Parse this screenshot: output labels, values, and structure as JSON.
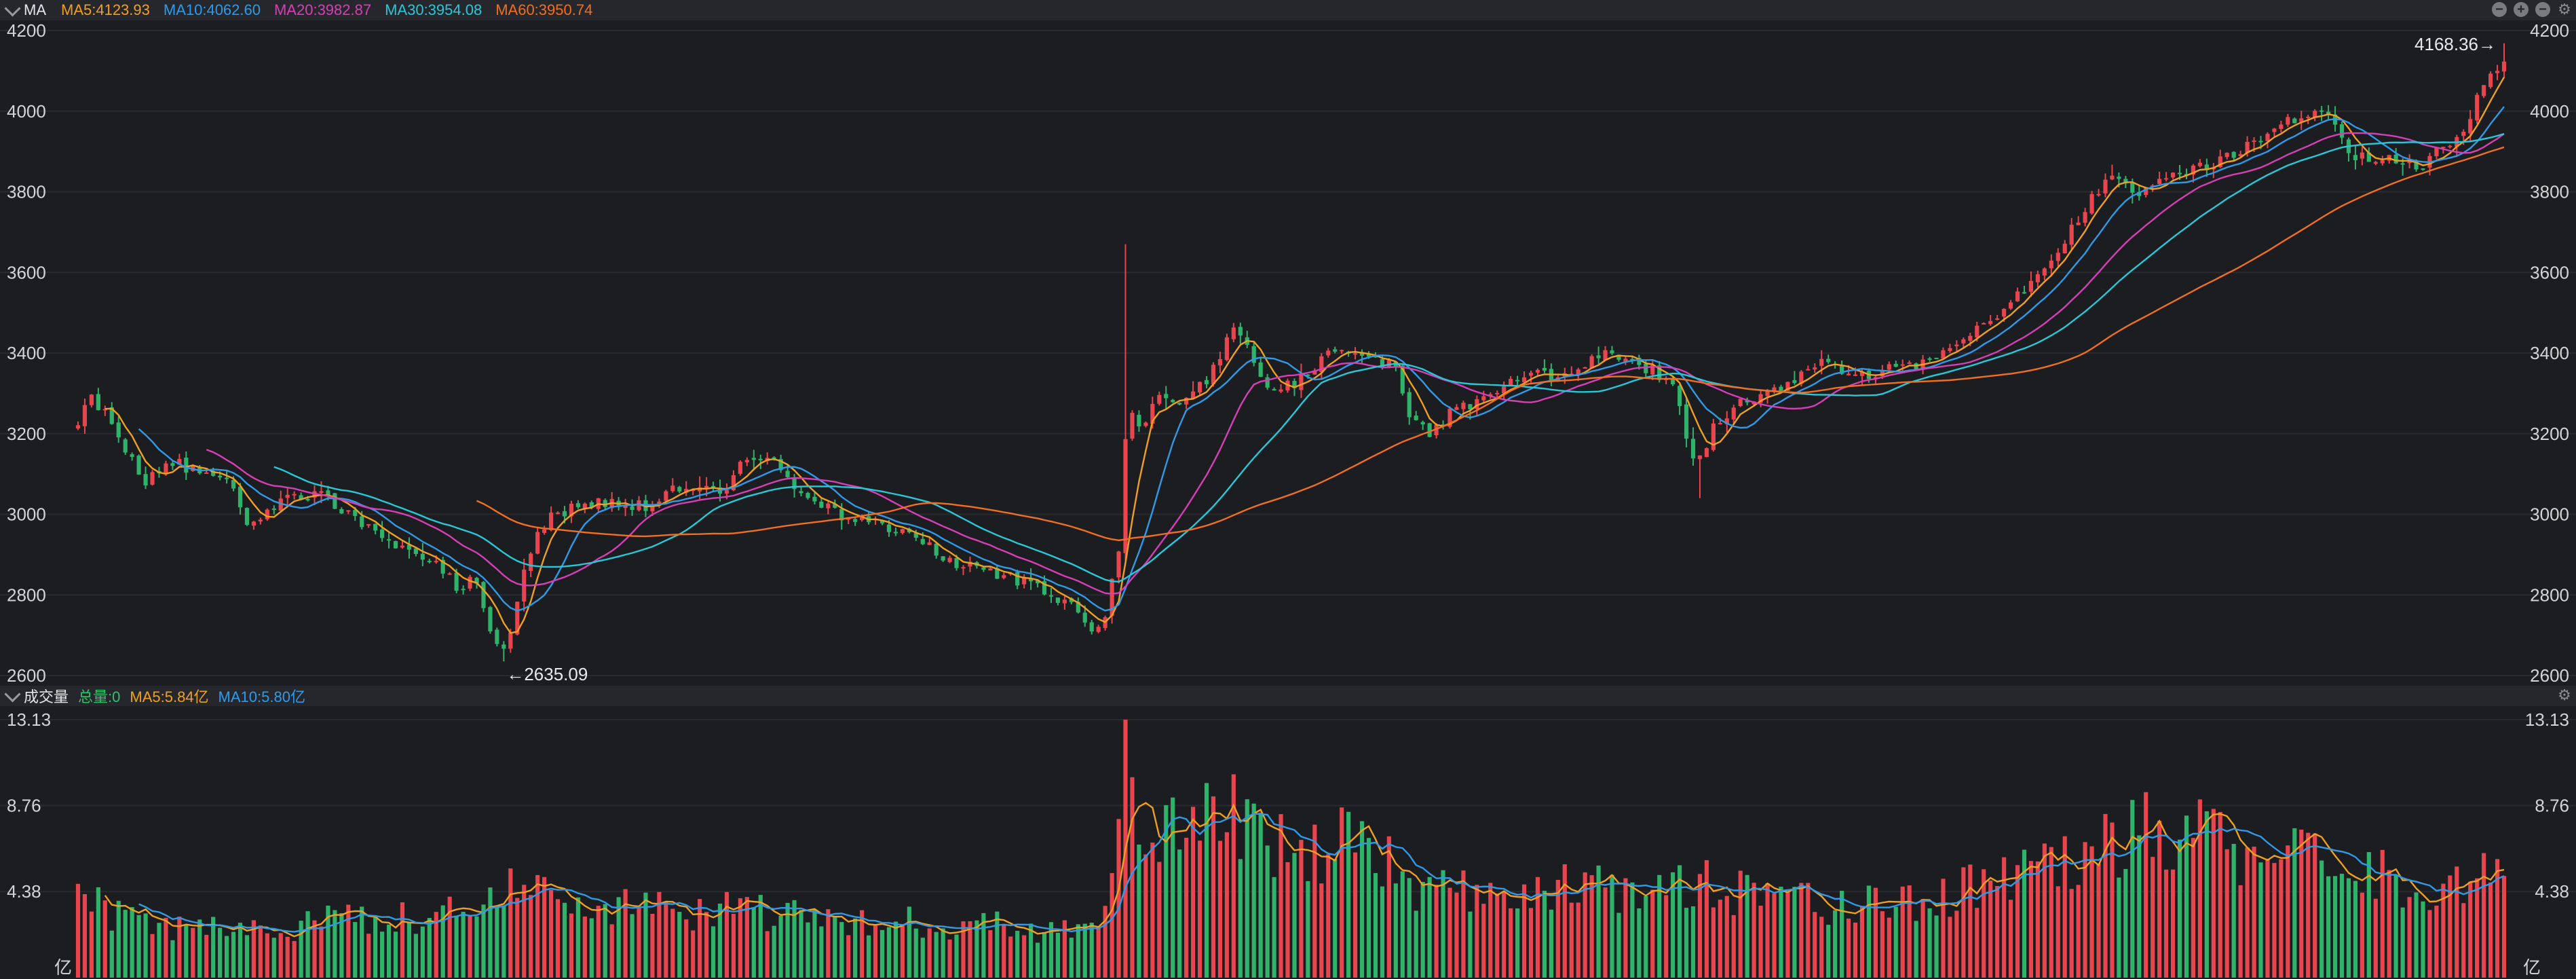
{
  "price_panel": {
    "title": "MA",
    "legend": [
      {
        "label": "MA5:4123.93",
        "color": "#f0a020"
      },
      {
        "label": "MA10:4062.60",
        "color": "#2f9be8"
      },
      {
        "label": "MA20:3982.87",
        "color": "#d63fb6"
      },
      {
        "label": "MA30:3954.08",
        "color": "#28c8d8"
      },
      {
        "label": "MA60:3950.74",
        "color": "#f07020"
      }
    ],
    "controls": [
      "minus-icon",
      "plus-icon",
      "minus-icon",
      "gear-icon"
    ],
    "high_annotation": "4168.36→",
    "low_annotation": "←2635.09"
  },
  "volume_panel": {
    "title": "成交量",
    "legend": [
      {
        "label": "总量:0",
        "color": "#2fc26b"
      },
      {
        "label": "MA5:5.84亿",
        "color": "#f0a020"
      },
      {
        "label": "MA10:5.80亿",
        "color": "#2f9be8"
      }
    ],
    "unit_label": "亿"
  },
  "colors": {
    "up": "#e8454f",
    "down": "#2fb36b",
    "grid": "#2a2b30"
  },
  "chart_data": [
    {
      "type": "candlestick",
      "title": "MA",
      "y_ticks": [
        2600,
        2800,
        3000,
        3200,
        3400,
        3600,
        3800,
        4000,
        4200
      ],
      "y_tick_labels": [
        "2600",
        "2800",
        "3000",
        "3200",
        "3400",
        "3600",
        "3800",
        "4000",
        "4200"
      ],
      "ylim": [
        2600,
        4200
      ],
      "candle_count": 360,
      "close_path_estimate": [
        [
          0,
          3220
        ],
        [
          5,
          3290
        ],
        [
          10,
          3250
        ],
        [
          15,
          3180
        ],
        [
          20,
          3150
        ],
        [
          25,
          3060
        ],
        [
          28,
          3100
        ],
        [
          35,
          3130
        ],
        [
          45,
          3110
        ],
        [
          55,
          3090
        ],
        [
          60,
          3040
        ],
        [
          65,
          2970
        ],
        [
          70,
          3000
        ],
        [
          75,
          3030
        ],
        [
          85,
          3050
        ],
        [
          95,
          3040
        ],
        [
          105,
          2990
        ],
        [
          115,
          2940
        ],
        [
          125,
          2910
        ],
        [
          135,
          2880
        ],
        [
          140,
          2860
        ],
        [
          145,
          2800
        ],
        [
          150,
          2860
        ],
        [
          155,
          2720
        ],
        [
          162,
          2650
        ],
        [
          170,
          2900
        ],
        [
          180,
          3000
        ],
        [
          190,
          3020
        ],
        [
          200,
          3030
        ],
        [
          215,
          3020
        ],
        [
          225,
          3060
        ],
        [
          235,
          3060
        ],
        [
          245,
          3060
        ],
        [
          252,
          3140
        ],
        [
          262,
          3140
        ],
        [
          272,
          3070
        ],
        [
          282,
          3030
        ],
        [
          292,
          2990
        ],
        [
          302,
          2980
        ],
        [
          312,
          2960
        ],
        [
          322,
          2920
        ],
        [
          332,
          2880
        ],
        [
          345,
          2860
        ],
        [
          360,
          2830
        ],
        [
          375,
          2780
        ],
        [
          385,
          2720
        ],
        [
          390,
          2760
        ],
        [
          395,
          2920
        ],
        [
          398,
          3300
        ],
        [
          402,
          3200
        ],
        [
          410,
          3300
        ],
        [
          420,
          3280
        ],
        [
          430,
          3350
        ],
        [
          438,
          3460
        ],
        [
          445,
          3400
        ],
        [
          452,
          3300
        ],
        [
          460,
          3320
        ],
        [
          470,
          3370
        ],
        [
          478,
          3420
        ],
        [
          490,
          3380
        ],
        [
          500,
          3370
        ],
        [
          505,
          3230
        ],
        [
          512,
          3200
        ],
        [
          520,
          3250
        ],
        [
          530,
          3280
        ],
        [
          540,
          3320
        ],
        [
          550,
          3350
        ],
        [
          560,
          3340
        ],
        [
          570,
          3370
        ],
        [
          580,
          3400
        ],
        [
          588,
          3380
        ],
        [
          596,
          3360
        ],
        [
          604,
          3330
        ],
        [
          610,
          3200
        ],
        [
          614,
          3120
        ],
        [
          620,
          3210
        ],
        [
          630,
          3280
        ],
        [
          640,
          3300
        ],
        [
          650,
          3330
        ],
        [
          660,
          3380
        ],
        [
          670,
          3350
        ],
        [
          680,
          3340
        ],
        [
          690,
          3380
        ],
        [
          700,
          3370
        ],
        [
          712,
          3430
        ],
        [
          725,
          3480
        ],
        [
          735,
          3540
        ],
        [
          745,
          3600
        ],
        [
          755,
          3700
        ],
        [
          765,
          3800
        ],
        [
          775,
          3850
        ],
        [
          780,
          3780
        ],
        [
          790,
          3820
        ],
        [
          800,
          3850
        ],
        [
          810,
          3870
        ],
        [
          820,
          3900
        ],
        [
          830,
          3940
        ],
        [
          840,
          3980
        ],
        [
          848,
          4000
        ],
        [
          855,
          3980
        ],
        [
          860,
          3900
        ],
        [
          870,
          3880
        ],
        [
          880,
          3880
        ],
        [
          888,
          3850
        ],
        [
          895,
          3900
        ],
        [
          905,
          3960
        ],
        [
          912,
          4060
        ],
        [
          920,
          4140
        ]
      ],
      "annotations": [
        {
          "text": "4168.36→",
          "value": 4168.36
        },
        {
          "text": "←2635.09",
          "value": 2635.09
        }
      ],
      "series": [
        {
          "name": "MA5",
          "final_value": 4123.93
        },
        {
          "name": "MA10",
          "final_value": 4062.6
        },
        {
          "name": "MA20",
          "final_value": 3982.87
        },
        {
          "name": "MA30",
          "final_value": 3954.08
        },
        {
          "name": "MA60",
          "final_value": 3950.74
        }
      ]
    },
    {
      "type": "bar",
      "title": "成交量",
      "y_ticks": [
        4.38,
        8.76,
        13.13
      ],
      "y_tick_labels": [
        "4.38",
        "8.76",
        "13.13"
      ],
      "ylim": [
        0,
        13.13
      ],
      "unit": "亿",
      "volume_path_estimate": [
        [
          0,
          3.8
        ],
        [
          10,
          3.6
        ],
        [
          20,
          2.8
        ],
        [
          40,
          2.5
        ],
        [
          60,
          2.4
        ],
        [
          80,
          2.6
        ],
        [
          100,
          2.9
        ],
        [
          120,
          3.0
        ],
        [
          140,
          3.2
        ],
        [
          155,
          3.6
        ],
        [
          165,
          4.5
        ],
        [
          175,
          4.0
        ],
        [
          195,
          3.6
        ],
        [
          215,
          3.5
        ],
        [
          240,
          3.4
        ],
        [
          265,
          3.3
        ],
        [
          290,
          3.0
        ],
        [
          320,
          2.8
        ],
        [
          350,
          2.6
        ],
        [
          380,
          2.4
        ],
        [
          392,
          4.0
        ],
        [
          398,
          10.5
        ],
        [
          405,
          8.0
        ],
        [
          415,
          7.2
        ],
        [
          428,
          7.8
        ],
        [
          438,
          8.5
        ],
        [
          450,
          6.5
        ],
        [
          470,
          6.2
        ],
        [
          480,
          7.0
        ],
        [
          495,
          6.0
        ],
        [
          505,
          4.6
        ],
        [
          520,
          4.2
        ],
        [
          540,
          4.8
        ],
        [
          560,
          4.9
        ],
        [
          580,
          4.8
        ],
        [
          600,
          4.2
        ],
        [
          615,
          4.7
        ],
        [
          630,
          4.2
        ],
        [
          650,
          3.8
        ],
        [
          670,
          3.6
        ],
        [
          690,
          3.9
        ],
        [
          710,
          4.3
        ],
        [
          730,
          4.8
        ],
        [
          750,
          5.6
        ],
        [
          765,
          6.4
        ],
        [
          780,
          7.0
        ],
        [
          790,
          7.8
        ],
        [
          805,
          7.0
        ],
        [
          820,
          6.3
        ],
        [
          840,
          6.0
        ],
        [
          855,
          5.8
        ],
        [
          870,
          5.2
        ],
        [
          890,
          4.6
        ],
        [
          905,
          4.9
        ],
        [
          915,
          6.3
        ],
        [
          920,
          5.6
        ]
      ],
      "series": [
        {
          "name": "MA5",
          "final_value": 5.84
        },
        {
          "name": "MA10",
          "final_value": 5.8
        }
      ]
    }
  ]
}
